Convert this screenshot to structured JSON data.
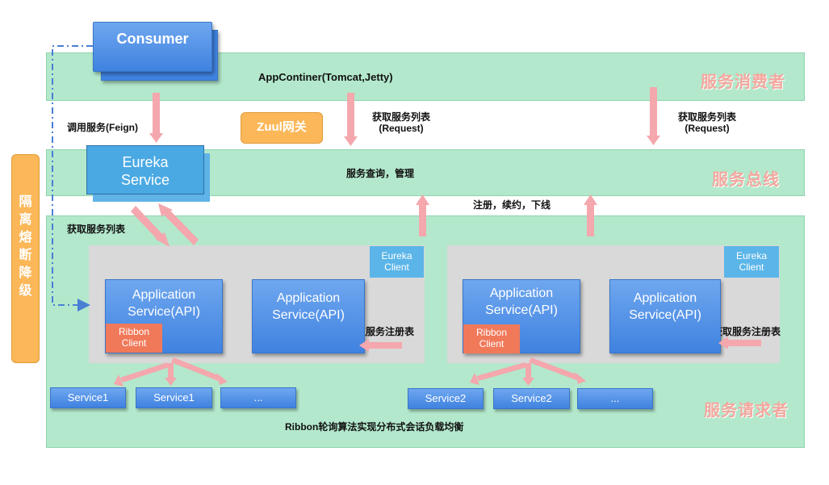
{
  "consumer": {
    "label": "Consumer"
  },
  "bands": {
    "consumer": {
      "title": "服务消费者",
      "container_label": "AppContiner(Tomcat,Jetty)"
    },
    "bus": {
      "title": "服务总线",
      "center_label": "服务查询，管理"
    },
    "provider": {
      "title": "服务请求者",
      "bottom_label": "Ribbon轮询算法实现分布式会话负载均衡"
    }
  },
  "eureka_service": {
    "line1": "Eureka",
    "line2": "Service"
  },
  "zuul": {
    "label": "Zuul网关"
  },
  "isolation": {
    "label": "隔离熔断降级"
  },
  "edge_labels": {
    "call_service": "调用服务(Feign)",
    "get_list_left": "获取服务列表",
    "get_list_request_1": {
      "line1": "获取服务列表",
      "line2": "(Request)"
    },
    "get_list_request_2": {
      "line1": "获取服务列表",
      "line2": "(Request)"
    },
    "register": "注册，续约，下线",
    "get_registry_1": "获取服务注册表",
    "get_registry_2": "获取服务注册表"
  },
  "clusters": [
    {
      "eureka_client": {
        "line1": "Eureka",
        "line2": "Client"
      },
      "app1": {
        "line1": "Application",
        "line2": "Service(API)"
      },
      "ribbon": {
        "line1": "Ribbon",
        "line2": "Client"
      },
      "app2": {
        "line1": "Application",
        "line2": "Service(API)"
      },
      "services": [
        "Service1",
        "Service1",
        "..."
      ]
    },
    {
      "eureka_client": {
        "line1": "Eureka",
        "line2": "Client"
      },
      "app1": {
        "line1": "Application",
        "line2": "Service(API)"
      },
      "ribbon": {
        "line1": "Ribbon",
        "line2": "Client"
      },
      "app2": {
        "line1": "Application",
        "line2": "Service(API)"
      },
      "services": [
        "Service2",
        "Service2",
        "..."
      ]
    }
  ],
  "colors": {
    "band": "#b3e8cc",
    "band_title": "#f3a79e",
    "arrow": "#f4a7ad",
    "blue_box": "#4a8ee6",
    "ribbon_box": "#f0795a",
    "eureka_client_box": "#5bb5e8",
    "orange_box": "#fbb758",
    "dashed_line": "#4a7fd6"
  }
}
